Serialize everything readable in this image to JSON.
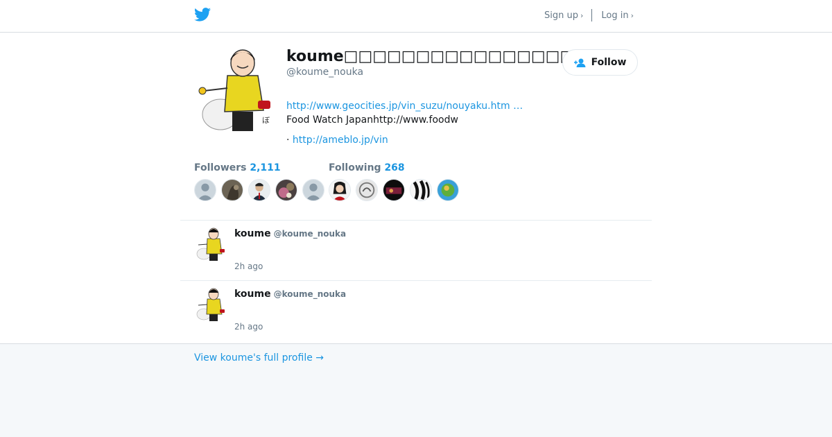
{
  "header": {
    "logo_icon": "twitter-bird-icon",
    "signup_label": "Sign up",
    "login_label": "Log in",
    "chevron": "›"
  },
  "profile": {
    "display_name": "koume□□□□□□□□□□□□□□□□□",
    "screen_name": "@koume_nouka",
    "follow_label": "Follow",
    "bio_url": "http://www.geocities.jp/vin_suzu/nouyaku.htm …",
    "bio_text": "Food Watch Japanhttp://www.foodw",
    "bio_link_prefix": "· ",
    "bio_link": "http://ameblo.jp/vin"
  },
  "stats": {
    "followers_label": "Followers",
    "followers_count": "2,111",
    "following_label": "Following",
    "following_count": "268"
  },
  "tweets": [
    {
      "name": "koume",
      "handle": "@koume_nouka",
      "time": "2h ago"
    },
    {
      "name": "koume",
      "handle": "@koume_nouka",
      "time": "2h ago"
    }
  ],
  "footer": {
    "full_profile_label": "View koume's full profile →"
  },
  "colors": {
    "accent": "#1b95e0",
    "twitter_blue": "#1da1f2",
    "muted": "#657786",
    "background": "#f5f8fa"
  }
}
